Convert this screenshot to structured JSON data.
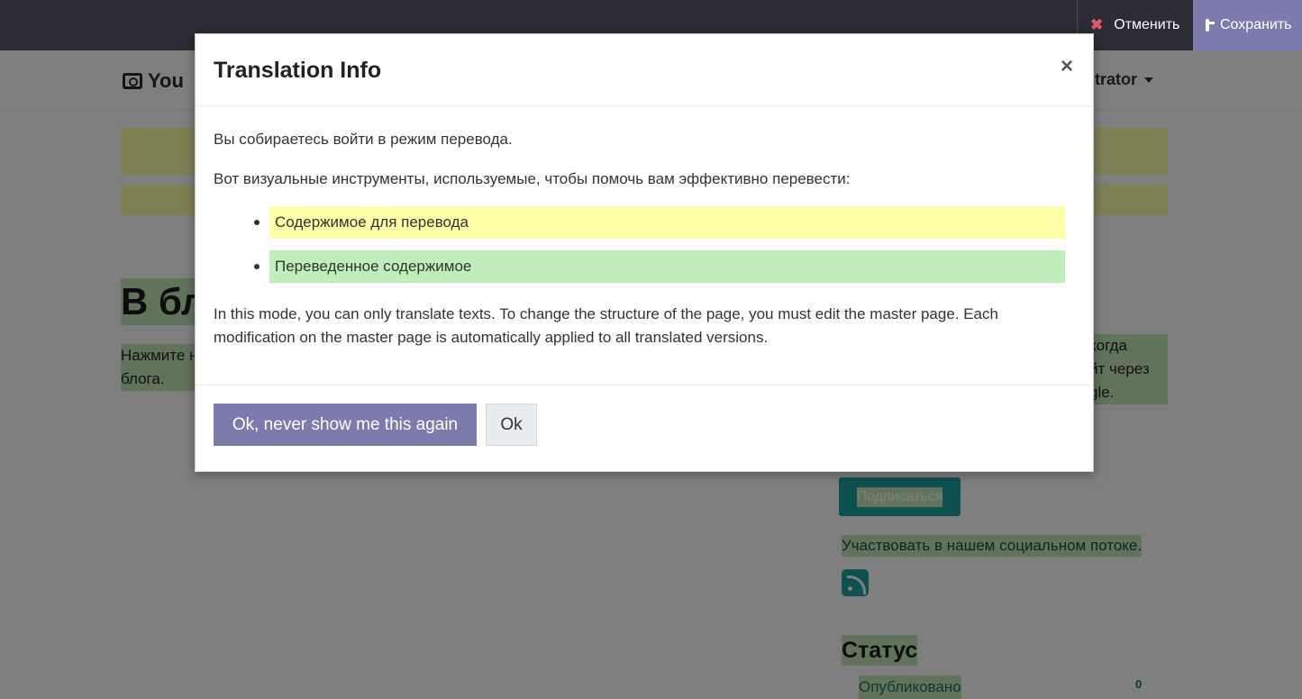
{
  "editor_bar": {
    "cancel_label": "Отменить",
    "save_label": "Сохранить",
    "accent_color": "#7c7bad"
  },
  "site": {
    "logo_text": "You",
    "user_menu_label": "strator",
    "blog_title": "В бл",
    "blog_description": "Нажмите н\nблога.",
    "right_note": "когда\nйт через\ngle.",
    "subscribe_label": "Подписаться",
    "social_text": "Участвовать в нашем социальном потоке.",
    "status_heading": "Статус",
    "status_item_label": "Опубликовано",
    "status_item_count": "0"
  },
  "modal": {
    "title": "Translation Info",
    "close_symbol": "×",
    "intro": "Вы собираетесь войти в режим перевода.",
    "tools_intro": "Вот визуальные инструменты, используемые, чтобы помочь вам эффективно перевести:",
    "legend": [
      {
        "label": "Содержимое для перевода",
        "color": "#ffffa8"
      },
      {
        "label": "Переведенное содержимое",
        "color": "#bfeebc"
      }
    ],
    "note": "In this mode, you can only translate texts. To change the structure of the page, you must edit the master page. Each modification on the master page is automatically applied to all translated versions.",
    "primary_button": "Ok, never show me this again",
    "secondary_button": "Ok"
  }
}
